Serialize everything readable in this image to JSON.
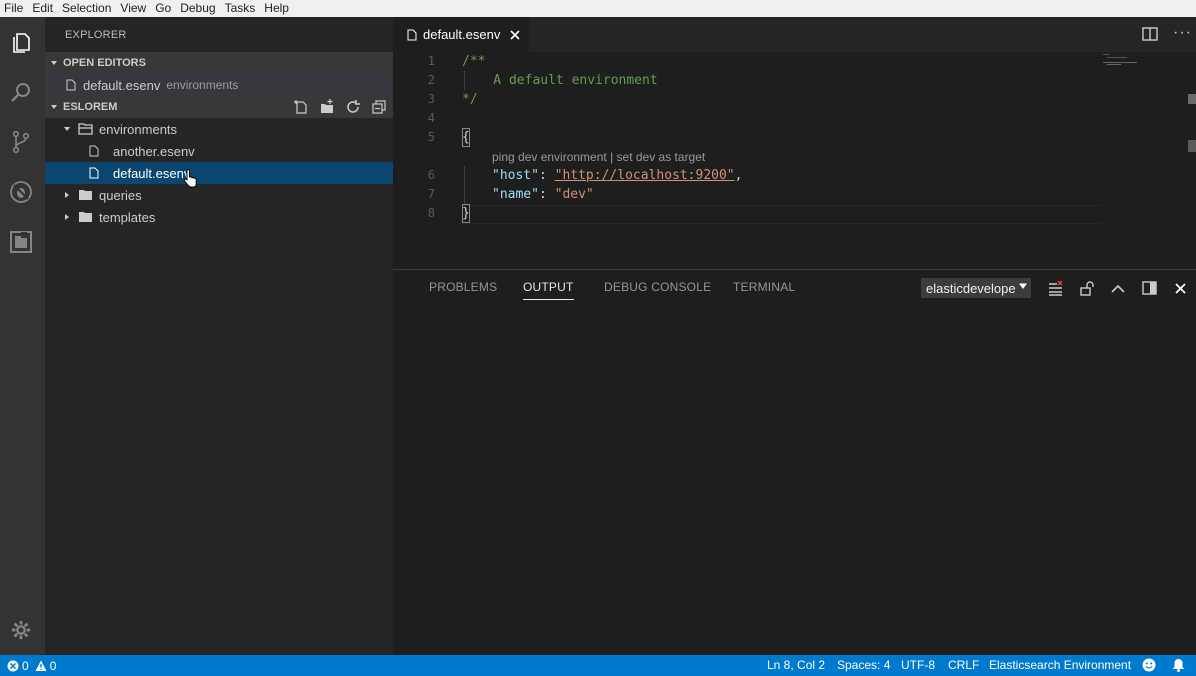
{
  "menu": [
    "File",
    "Edit",
    "Selection",
    "View",
    "Go",
    "Debug",
    "Tasks",
    "Help"
  ],
  "activity": [
    "files-icon",
    "search-icon",
    "source-control-icon",
    "debug-icon",
    "extensions-icon"
  ],
  "sidebar": {
    "title": "EXPLORER",
    "open_editors": {
      "label": "OPEN EDITORS",
      "items": [
        {
          "name": "default.esenv",
          "folder": "environments"
        }
      ]
    },
    "workspace": {
      "label": "ESLOREM",
      "tree": [
        {
          "label": "environments",
          "kind": "folder",
          "expanded": true
        },
        {
          "label": "another.esenv",
          "kind": "file"
        },
        {
          "label": "default.esenv",
          "kind": "file",
          "selected": true
        },
        {
          "label": "queries",
          "kind": "folder",
          "expanded": false
        },
        {
          "label": "templates",
          "kind": "folder",
          "expanded": false
        }
      ]
    }
  },
  "editor": {
    "tab_label": "default.esenv",
    "line_numbers": [
      "1",
      "2",
      "3",
      "4",
      "5",
      "6",
      "7",
      "8"
    ],
    "lines": {
      "l1": "/**",
      "l2": "    A default environment",
      "l3": "*/",
      "l5": "{",
      "l6_key": "\"host\"",
      "l6_colon": ": ",
      "l6_value": "\"http://localhost:9200\"",
      "l6_comma": ",",
      "l7_key": "\"name\"",
      "l7_colon": ": ",
      "l7_value": "\"dev\"",
      "l8": "}"
    },
    "codelens": "ping dev environment | set dev as target"
  },
  "panel": {
    "tabs": [
      "PROBLEMS",
      "OUTPUT",
      "DEBUG CONSOLE",
      "TERMINAL"
    ],
    "active_tab": "OUTPUT",
    "output_channel": "elasticdevelope"
  },
  "statusbar": {
    "errors": "0",
    "warnings": "0",
    "position": "Ln 8, Col 2",
    "spaces": "Spaces: 4",
    "encoding": "UTF-8",
    "eol": "CRLF",
    "language": "Elasticsearch Environment"
  },
  "colors": {
    "accent": "#007acc",
    "selection": "#094771",
    "comment": "#6a9955",
    "key": "#9cdcfe",
    "string": "#ce9178"
  }
}
